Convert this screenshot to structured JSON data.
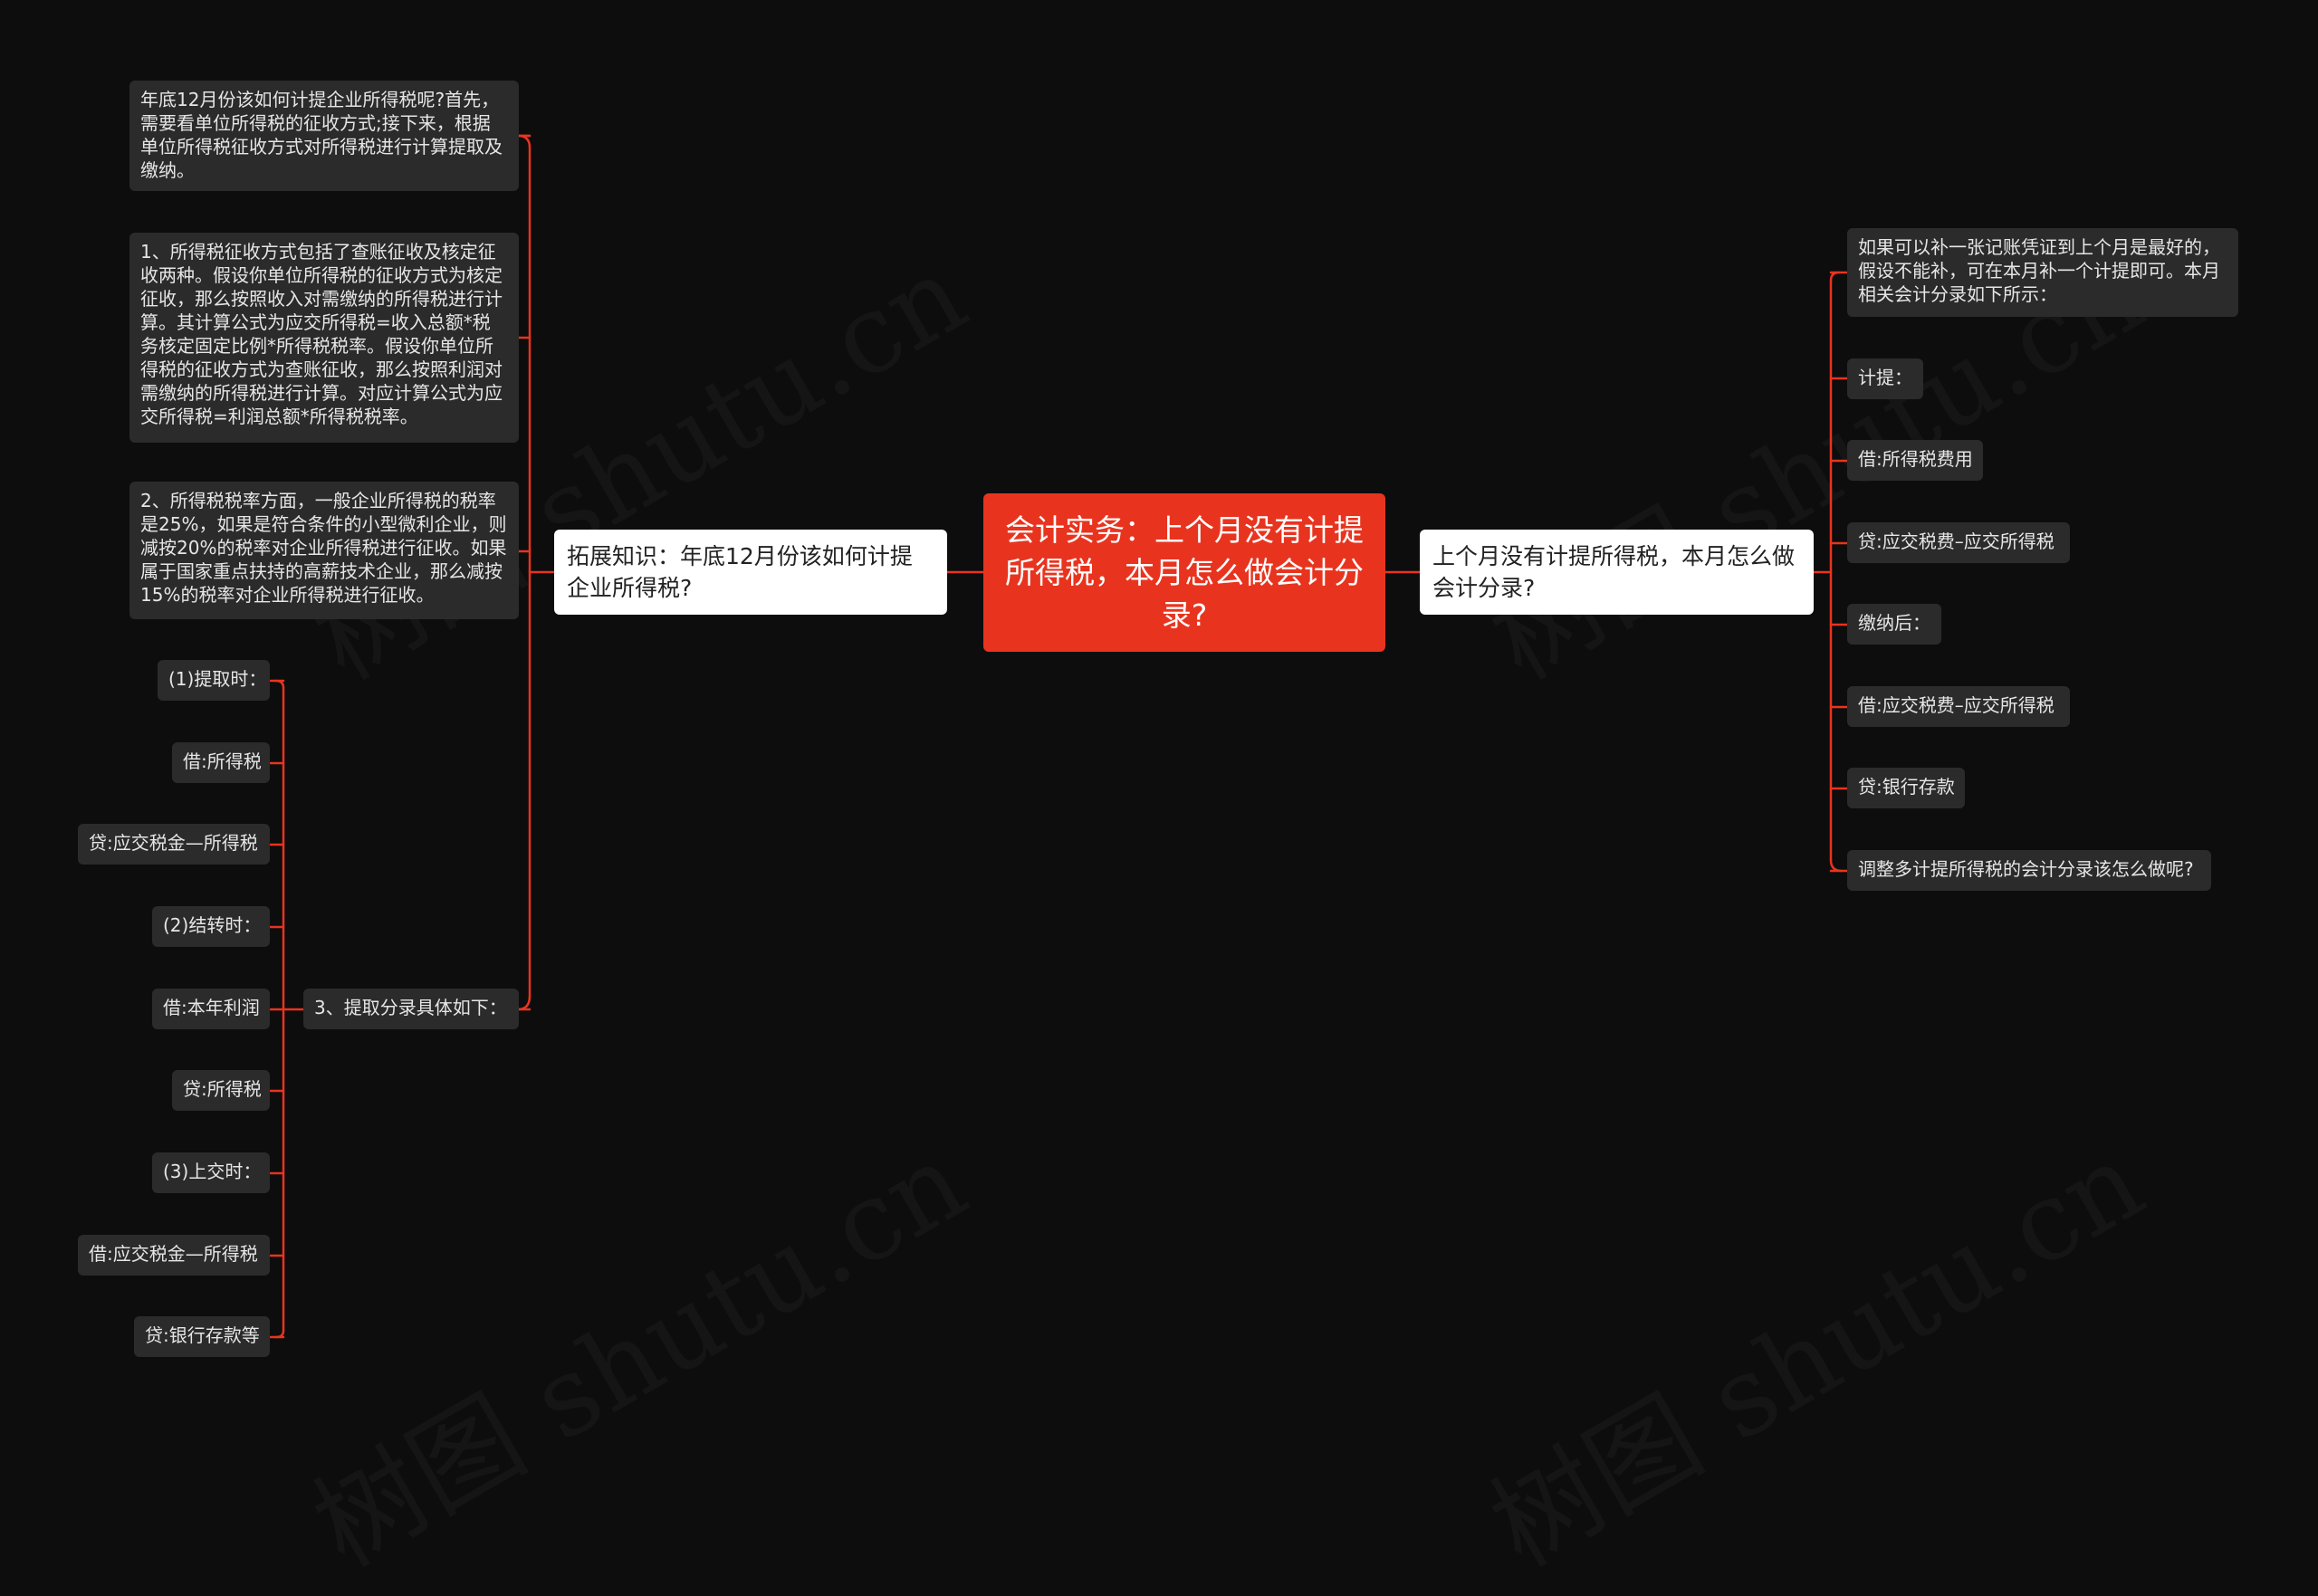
{
  "root": {
    "title": "会计实务：上个月没有计提所得税，本月怎么做会计分录?"
  },
  "left_branch": {
    "title": "拓展知识：年底12月份该如何计提企业所得税?",
    "intro": "年底12月份该如何计提企业所得税呢?首先，需要看单位所得税的征收方式;接下来，根据单位所得税征收方式对所得税进行计算提取及缴纳。",
    "point1": "1、所得税征收方式包括了查账征收及核定征收两种。假设你单位所得税的征收方式为核定征收，那么按照收入对需缴纳的所得税进行计算。其计算公式为应交所得税=收入总额*税务核定固定比例*所得税税率。假设你单位所得税的征收方式为查账征收，那么按照利润对需缴纳的所得税进行计算。对应计算公式为应交所得税=利润总额*所得税税率。",
    "point2": "2、所得税税率方面，一般企业所得税的税率是25%，如果是符合条件的小型微利企业，则减按20%的税率对企业所得税进行征收。如果属于国家重点扶持的高薪技术企业，那么减按15%的税率对企业所得税进行征收。",
    "point3": {
      "title": "3、提取分录具体如下：",
      "items": [
        "(1)提取时：",
        "借:所得税",
        "贷:应交税金—所得税",
        "(2)结转时：",
        "借:本年利润",
        "贷:所得税",
        "(3)上交时：",
        "借:应交税金—所得税",
        "贷:银行存款等"
      ]
    }
  },
  "right_branch": {
    "title": "上个月没有计提所得税，本月怎么做会计分录?",
    "items": [
      "如果可以补一张记账凭证到上个月是最好的，假设不能补，可在本月补一个计提即可。本月相关会计分录如下所示：",
      "计提：",
      "借:所得税费用",
      "贷:应交税费–应交所得税",
      "缴纳后：",
      "借:应交税费–应交所得税",
      "贷:银行存款",
      "调整多计提所得税的会计分录该怎么做呢?"
    ]
  },
  "watermark": "树图 shutu.cn",
  "colors": {
    "background": "#0d0d0d",
    "root": "#e8341f",
    "connector": "#e8341f",
    "leaf": "#2b2b2b",
    "main": "#ffffff"
  }
}
